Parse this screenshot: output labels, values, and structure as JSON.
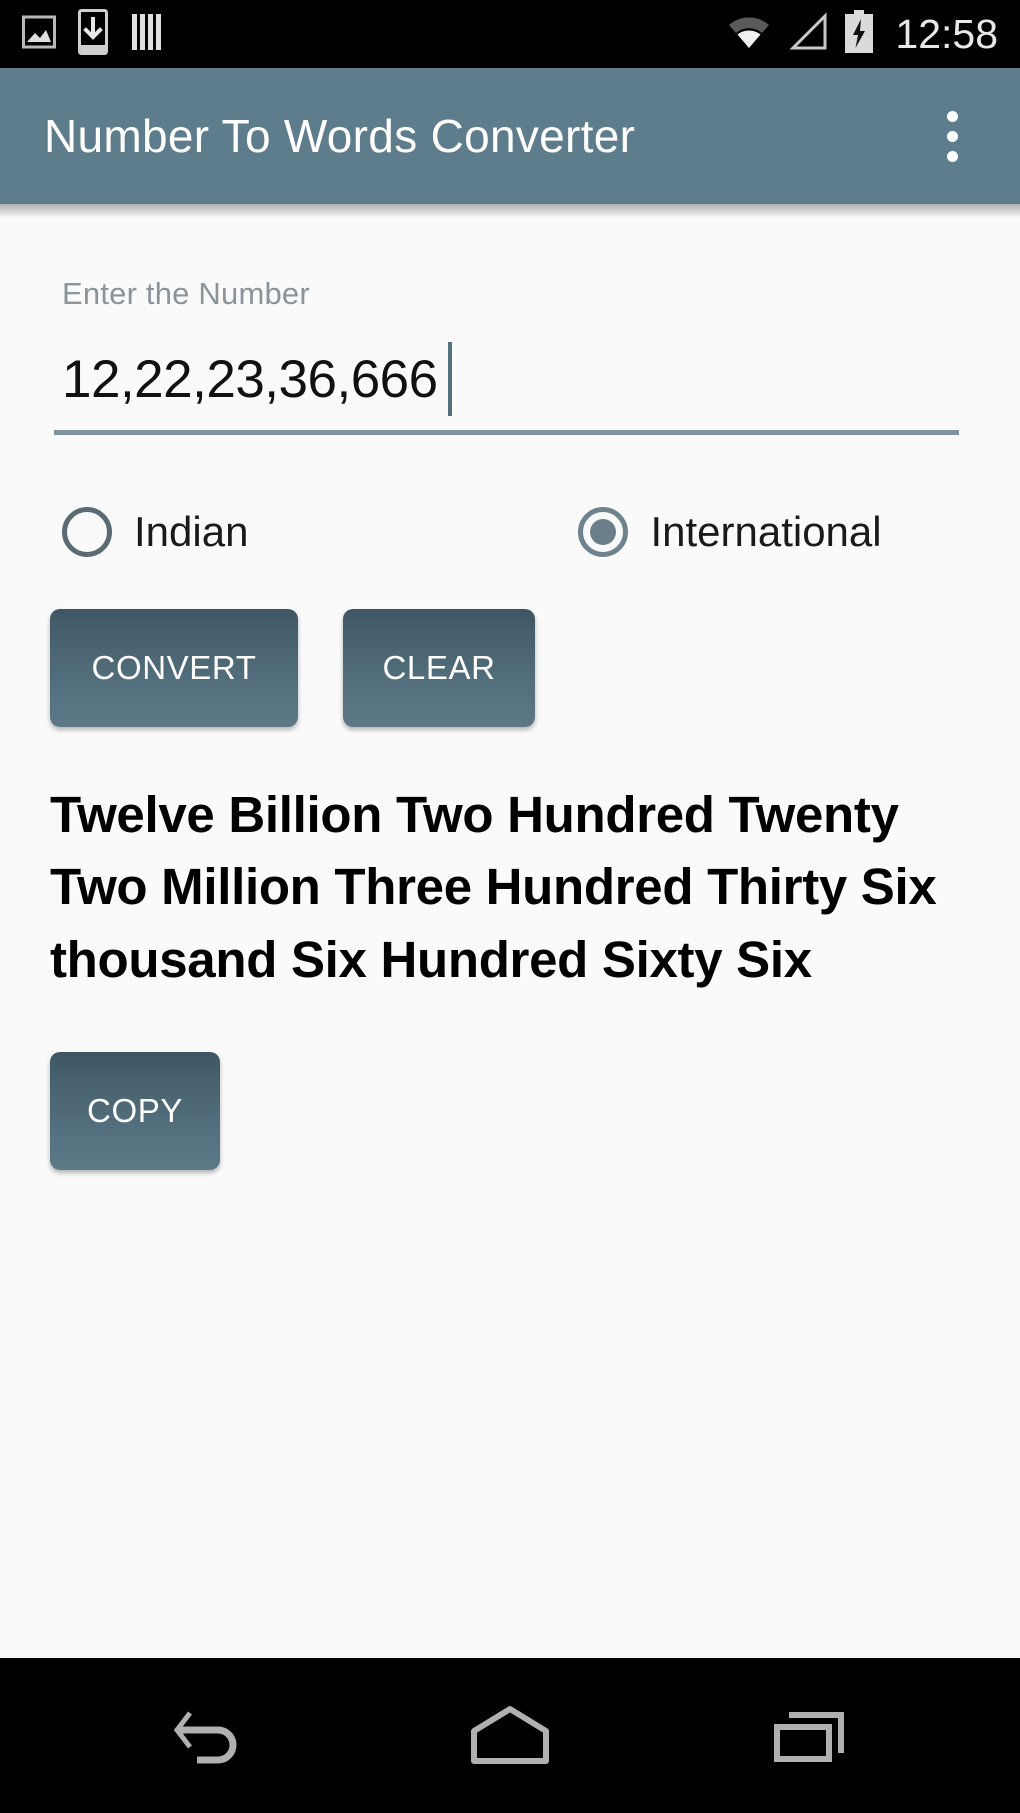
{
  "status_bar": {
    "time": "12:58",
    "left_icons": [
      "image-icon",
      "download-icon",
      "vertical-bars-icon"
    ],
    "right_icons": [
      "wifi-icon",
      "signal-no-service-icon",
      "battery-charging-icon"
    ]
  },
  "app_bar": {
    "title": "Number To Words Converter",
    "overflow_icon": "overflow-menu-icon",
    "background_color": "#5E7D8C"
  },
  "form": {
    "label": "Enter the Number",
    "value": "12,22,23,36,666",
    "placeholder": "Enter the Number"
  },
  "system": {
    "options": [
      {
        "label": "Indian",
        "selected": false
      },
      {
        "label": "International",
        "selected": true
      }
    ]
  },
  "actions": {
    "convert_label": "CONVERT",
    "clear_label": "CLEAR",
    "copy_label": "COPY",
    "button_color": "#4E6A78"
  },
  "result": {
    "text": "Twelve Billion Two Hundred Twenty Two Million Three Hundred Thirty Six thousand Six Hundred Sixty Six"
  },
  "nav_bar": {
    "back_icon": "back-arrow-icon",
    "home_icon": "home-icon",
    "recents_icon": "recent-apps-icon"
  }
}
